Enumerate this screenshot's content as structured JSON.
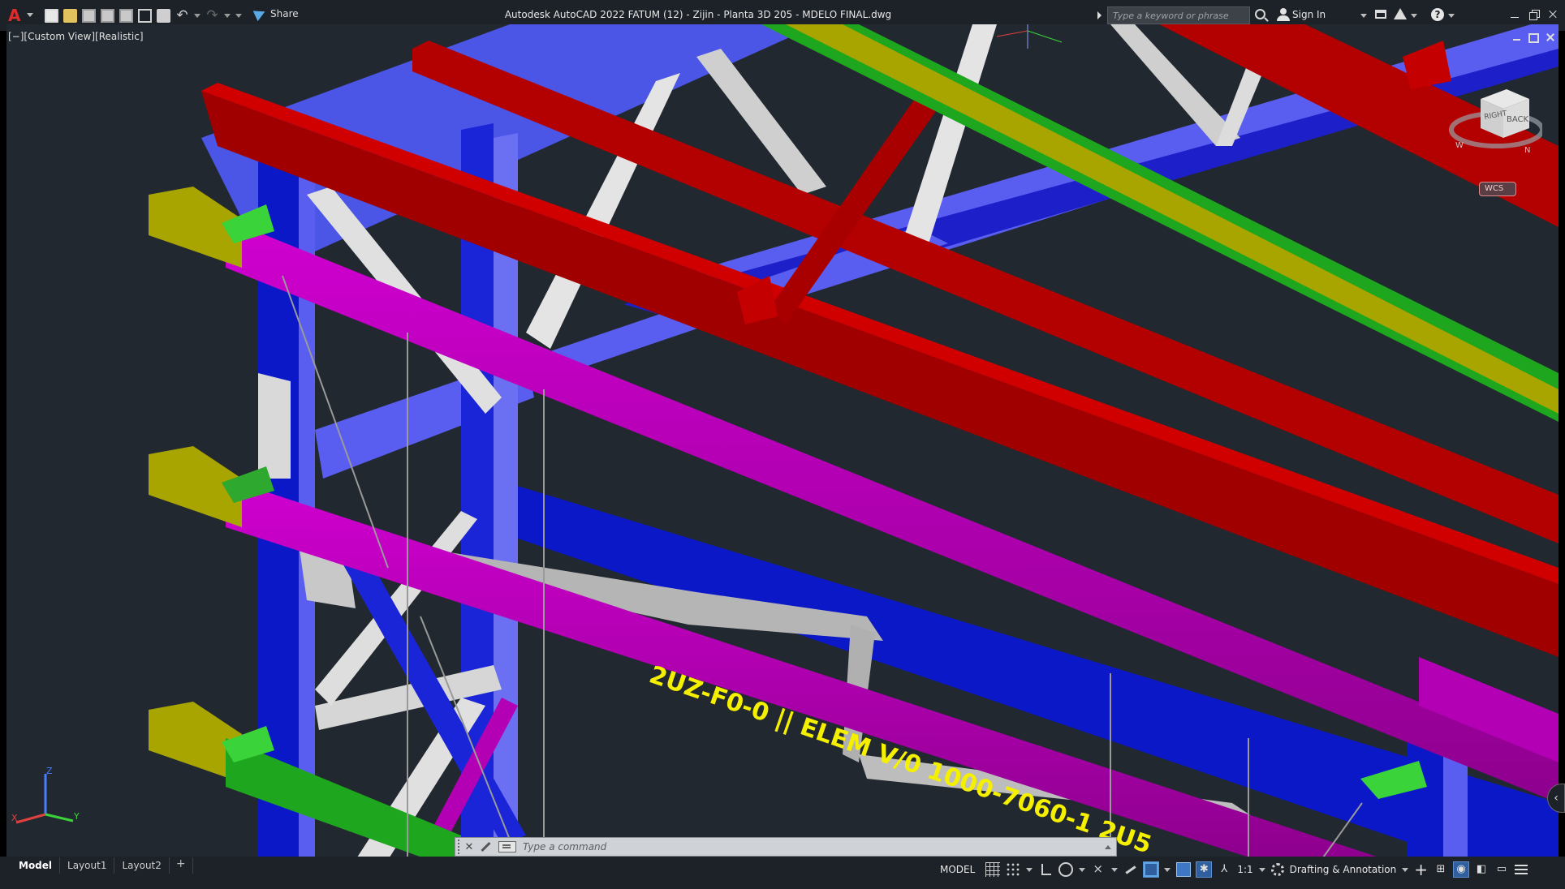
{
  "titlebar": {
    "app_logo": "A",
    "window_title": "Autodesk AutoCAD 2022    FATUM (12) - Zijin - Planta 3D 205 - MDELO FINAL.dwg",
    "share_label": "Share",
    "search_placeholder": "Type a keyword or phrase",
    "sign_in_label": "Sign In",
    "help_glyph": "?"
  },
  "quick_access": {
    "icons": [
      "new-icon",
      "open-icon",
      "save-icon",
      "save-as-icon",
      "save-to-web-icon",
      "plot-preview-icon",
      "plot-icon",
      "undo-icon",
      "redo-icon"
    ],
    "undo_glyph": "↶",
    "redo_glyph": "↷"
  },
  "viewport": {
    "view_label": "[−][Custom View][Realistic]",
    "viewcube": {
      "face_right": "RIGHT",
      "face_back": "BACK",
      "compass_w": "W",
      "compass_n": "N"
    },
    "wcs_label": "WCS",
    "ucs": {
      "x": "X",
      "y": "Y",
      "z": "Z"
    },
    "model_text": "2UZ-F0-0 || ELEM V/0 1000-7060-1 2U5",
    "colors": {
      "background": "#212830",
      "red_beam": "#b40000",
      "magenta_beam": "#b400b4",
      "blue_frame": "#0a1ad2",
      "blue_light": "#5a5ef0",
      "yellow": "#a8a400",
      "green": "#1ea61e",
      "grey_brace": "#bdbdbd"
    }
  },
  "command_line": {
    "placeholder": "Type a command",
    "close_glyph": "✕"
  },
  "statusbar": {
    "tabs": [
      "Model",
      "Layout1",
      "Layout2"
    ],
    "add_tab_glyph": "+",
    "model_space_label": "MODEL",
    "scale_label": "1:1",
    "workspace_label": "Drafting & Annotation"
  }
}
